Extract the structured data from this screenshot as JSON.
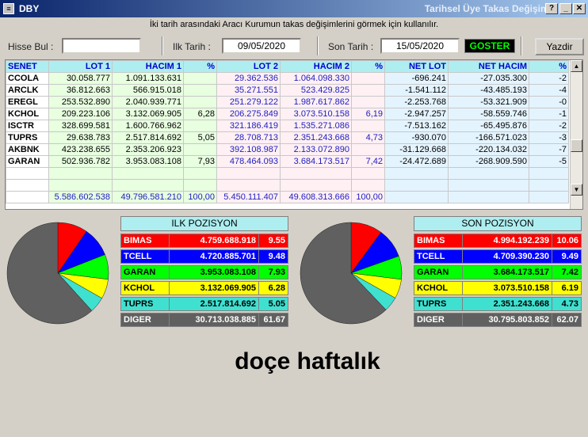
{
  "window": {
    "app_title": "DBY",
    "title": "Tarihsel Üye Takas Değişimi",
    "icon_glyph": "≡",
    "help_glyph": "?",
    "minimize_glyph": "_",
    "close_glyph": "✕"
  },
  "description": "İki tarih arasındaki  Aracı Kurumun takas değişimlerini görmek için kullanılır.",
  "toolbar": {
    "search_label": "Hisse Bul :",
    "search_value": "",
    "start_label": "Ilk Tarih :",
    "start_date": "09/05/2020",
    "end_label": "Son Tarih :",
    "end_date": "15/05/2020",
    "show_label": "GOSTER",
    "print_label": "Yazdir"
  },
  "grid": {
    "headers": [
      "SENET",
      "LOT 1",
      "HACIM 1",
      "%",
      "LOT 2",
      "HACIM 2",
      "%",
      "NET LOT",
      "NET HACIM",
      "%"
    ],
    "rows": [
      [
        "CCOLA",
        "30.058.777",
        "1.091.133.631",
        "",
        "29.362.536",
        "1.064.098.330",
        "",
        "-696.241",
        "-27.035.300",
        "-2"
      ],
      [
        "ARCLK",
        "36.812.663",
        "566.915.018",
        "",
        "35.271.551",
        "523.429.825",
        "",
        "-1.541.112",
        "-43.485.193",
        "-4"
      ],
      [
        "EREGL",
        "253.532.890",
        "2.040.939.771",
        "",
        "251.279.122",
        "1.987.617.862",
        "",
        "-2.253.768",
        "-53.321.909",
        "-0"
      ],
      [
        "KCHOL",
        "209.223.106",
        "3.132.069.905",
        "6,28",
        "206.275.849",
        "3.073.510.158",
        "6,19",
        "-2.947.257",
        "-58.559.746",
        "-1"
      ],
      [
        "ISCTR",
        "328.699.581",
        "1.600.766.962",
        "",
        "321.186.419",
        "1.535.271.086",
        "",
        "-7.513.162",
        "-65.495.876",
        "-2"
      ],
      [
        "TUPRS",
        "29.638.783",
        "2.517.814.692",
        "5,05",
        "28.708.713",
        "2.351.243.668",
        "4,73",
        "-930.070",
        "-166.571.023",
        "-3"
      ],
      [
        "AKBNK",
        "423.238.655",
        "2.353.206.923",
        "",
        "392.108.987",
        "2.133.072.890",
        "",
        "-31.129.668",
        "-220.134.032",
        "-7"
      ],
      [
        "GARAN",
        "502.936.782",
        "3.953.083.108",
        "7,93",
        "478.464.093",
        "3.684.173.517",
        "7,42",
        "-24.472.689",
        "-268.909.590",
        "-5"
      ]
    ],
    "totals": [
      "",
      "5.586.602.538",
      "49.796.581.210",
      "100,00",
      "5.450.111.407",
      "49.608.313.666",
      "100,00",
      "",
      "",
      ""
    ]
  },
  "ilk_pozisyon": {
    "title": "ILK POZISYON",
    "rows": [
      {
        "name": "BIMAS",
        "hacim": "4.759.688.918",
        "pct": "9.55",
        "bg": "#ff0000",
        "fg": "#ffffff"
      },
      {
        "name": "TCELL",
        "hacim": "4.720.885.701",
        "pct": "9.48",
        "bg": "#0000ff",
        "fg": "#ffffff"
      },
      {
        "name": "GARAN",
        "hacim": "3.953.083.108",
        "pct": "7.93",
        "bg": "#00ff00",
        "fg": "#000000"
      },
      {
        "name": "KCHOL",
        "hacim": "3.132.069.905",
        "pct": "6.28",
        "bg": "#ffff00",
        "fg": "#000000"
      },
      {
        "name": "TUPRS",
        "hacim": "2.517.814.692",
        "pct": "5.05",
        "bg": "#40e0d0",
        "fg": "#000000"
      },
      {
        "name": "DIGER",
        "hacim": "30.713.038.885",
        "pct": "61.67",
        "bg": "#606060",
        "fg": "#ffffff"
      }
    ]
  },
  "son_pozisyon": {
    "title": "SON POZISYON",
    "rows": [
      {
        "name": "BIMAS",
        "hacim": "4.994.192.239",
        "pct": "10.06",
        "bg": "#ff0000",
        "fg": "#ffffff"
      },
      {
        "name": "TCELL",
        "hacim": "4.709.390.230",
        "pct": "9.49",
        "bg": "#0000ff",
        "fg": "#ffffff"
      },
      {
        "name": "GARAN",
        "hacim": "3.684.173.517",
        "pct": "7.42",
        "bg": "#00ff00",
        "fg": "#000000"
      },
      {
        "name": "KCHOL",
        "hacim": "3.073.510.158",
        "pct": "6.19",
        "bg": "#ffff00",
        "fg": "#000000"
      },
      {
        "name": "TUPRS",
        "hacim": "2.351.243.668",
        "pct": "4.73",
        "bg": "#40e0d0",
        "fg": "#000000"
      },
      {
        "name": "DIGER",
        "hacim": "30.795.803.852",
        "pct": "62.07",
        "bg": "#606060",
        "fg": "#ffffff"
      }
    ]
  },
  "caption": "doçe haftalık"
}
